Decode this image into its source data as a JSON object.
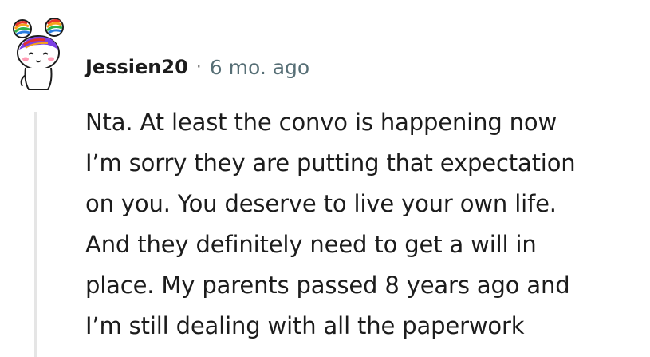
{
  "comment": {
    "author": "Jessien20",
    "separator": "·",
    "age": "6 mo. ago",
    "avatar_icon": "snoo-avatar-icon",
    "body_lines": [
      "Nta. At least the convo is happening now",
      "I’m sorry they are putting that expectation",
      "on you. You deserve to live your own life.",
      "And they definitely need to get a will in",
      "place. My parents passed 8 years ago and",
      "I’m still dealing with all the paperwork"
    ]
  },
  "colors": {
    "text": "#1c1c1c",
    "meta": "#576f76",
    "thread_line": "#e5e5e5"
  }
}
